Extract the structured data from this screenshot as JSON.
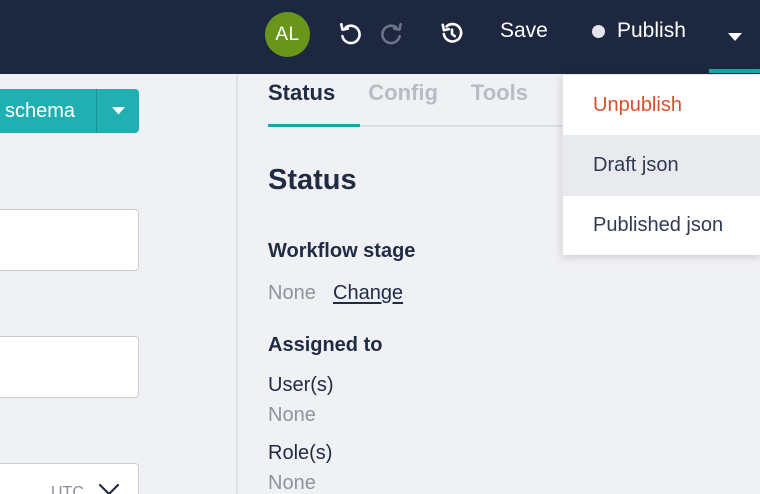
{
  "topbar": {
    "avatar_initials": "AL",
    "undo_icon": "undo-icon",
    "redo_icon": "redo-icon",
    "history_icon": "history-icon",
    "save_label": "Save",
    "publish_label": "Publish",
    "publish_status_color": "#e3e5ea",
    "caret_icon": "caret-down-icon"
  },
  "left": {
    "schema_button_label": "schema",
    "schema_caret_icon": "caret-down-icon",
    "date_field_suffix": "UTC",
    "date_field_chevron": "chevron-down-icon"
  },
  "status_panel": {
    "tabs": [
      {
        "label": "Status",
        "active": true
      },
      {
        "label": "Config",
        "active": false
      },
      {
        "label": "Tools",
        "active": false
      }
    ],
    "title": "Status",
    "workflow_stage_label": "Workflow stage",
    "workflow_stage_value": "None",
    "change_link": "Change",
    "assigned_to_label": "Assigned to",
    "users_label": "User(s)",
    "users_value": "None",
    "roles_label": "Role(s)",
    "roles_value": "None"
  },
  "publish_menu": {
    "items": [
      {
        "label": "Unpublish",
        "style": "danger"
      },
      {
        "label": "Draft json",
        "style": "hover"
      },
      {
        "label": "Published json",
        "style": "normal"
      }
    ]
  },
  "colors": {
    "topbar_bg": "#1d2740",
    "accent": "#21b0b2",
    "avatar_bg": "#69951a",
    "danger": "#d94f2b",
    "page_bg": "#f0f1f4"
  }
}
